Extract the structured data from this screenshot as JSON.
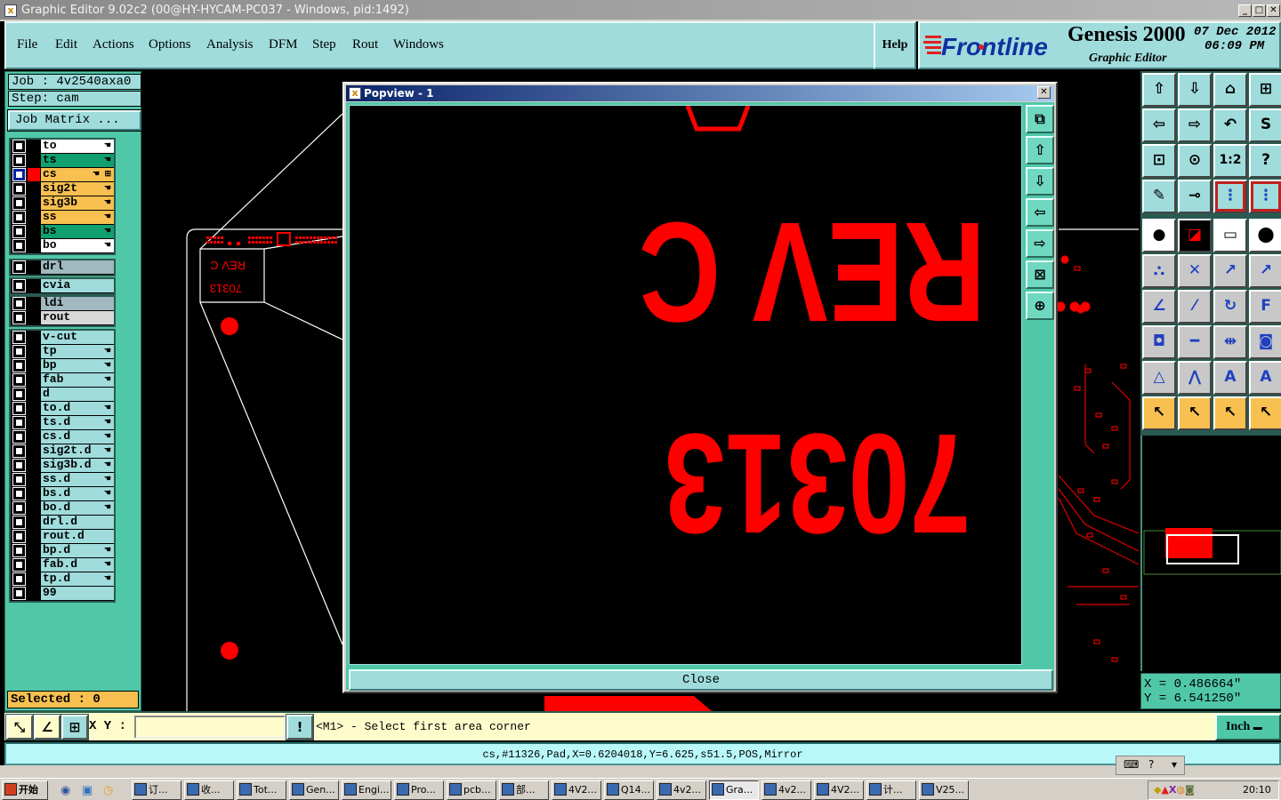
{
  "window": {
    "title": "Graphic Editor 9.02c2 (00@HY-HYCAM-PC037 - Windows, pid:1492)",
    "min": "_",
    "max": "□",
    "close": "✕"
  },
  "menu": {
    "items": [
      {
        "label": "File",
        "x": 0
      },
      {
        "label": "Edit"
      },
      {
        "label": "Actions"
      },
      {
        "label": "Options"
      },
      {
        "label": "Analysis"
      },
      {
        "label": "DFM"
      },
      {
        "label": "Step"
      },
      {
        "label": "Rout"
      },
      {
        "label": "Windows"
      }
    ],
    "help": "Help"
  },
  "branding": {
    "logo": "Frontline",
    "product": "Genesis 2000",
    "subtitle": "Graphic Editor",
    "date": "07 Dec 2012",
    "time": "06:09 PM"
  },
  "job": {
    "job_label": "Job : 4v2540axa0",
    "step_label": "Step: cam",
    "job_matrix": "Job Matrix ...",
    "selected": "Selected : 0"
  },
  "colors": {
    "orange": "#f8c050",
    "green": "#10a070",
    "white": "#ffffff",
    "gray": "#a0b8c0",
    "lightgray": "#d8d8d8",
    "teal": "#a0dcdc",
    "pcb_red": "#ff0000",
    "panel": "#50c8a8"
  },
  "layers": [
    {
      "name": "to",
      "color": "white",
      "hand": true,
      "group": 0
    },
    {
      "name": "ts",
      "color": "green",
      "hand": true,
      "group": 0
    },
    {
      "name": "cs",
      "color": "orange",
      "hand": true,
      "group": 0,
      "active": true
    },
    {
      "name": "sig2t",
      "color": "orange",
      "hand": true,
      "group": 0
    },
    {
      "name": "sig3b",
      "color": "orange",
      "hand": true,
      "group": 0
    },
    {
      "name": "ss",
      "color": "orange",
      "hand": true,
      "group": 0
    },
    {
      "name": "bs",
      "color": "green",
      "hand": true,
      "group": 0
    },
    {
      "name": "bo",
      "color": "white",
      "hand": true,
      "group": 0
    },
    {
      "name": "drl",
      "color": "gray",
      "hand": false,
      "group": 1
    },
    {
      "name": "cvia",
      "color": "teal",
      "hand": false,
      "group": 2
    },
    {
      "name": "ldi",
      "color": "gray",
      "hand": false,
      "group": 3
    },
    {
      "name": "rout",
      "color": "lightgray",
      "hand": false,
      "group": 3
    },
    {
      "name": "v-cut",
      "color": "teal",
      "hand": false,
      "group": 4
    },
    {
      "name": "tp",
      "color": "teal",
      "hand": true,
      "group": 4
    },
    {
      "name": "bp",
      "color": "teal",
      "hand": true,
      "group": 4
    },
    {
      "name": "fab",
      "color": "teal",
      "hand": true,
      "group": 4
    },
    {
      "name": "d",
      "color": "teal",
      "hand": false,
      "group": 4
    },
    {
      "name": "to.d",
      "color": "teal",
      "hand": true,
      "group": 4
    },
    {
      "name": "ts.d",
      "color": "teal",
      "hand": true,
      "group": 4
    },
    {
      "name": "cs.d",
      "color": "teal",
      "hand": true,
      "group": 4
    },
    {
      "name": "sig2t.d",
      "color": "teal",
      "hand": true,
      "group": 4
    },
    {
      "name": "sig3b.d",
      "color": "teal",
      "hand": true,
      "group": 4
    },
    {
      "name": "ss.d",
      "color": "teal",
      "hand": true,
      "group": 4
    },
    {
      "name": "bs.d",
      "color": "teal",
      "hand": true,
      "group": 4
    },
    {
      "name": "bo.d",
      "color": "teal",
      "hand": true,
      "group": 4
    },
    {
      "name": "drl.d",
      "color": "teal",
      "hand": false,
      "group": 4
    },
    {
      "name": "rout.d",
      "color": "teal",
      "hand": false,
      "group": 4
    },
    {
      "name": "bp.d",
      "color": "teal",
      "hand": true,
      "group": 4
    },
    {
      "name": "fab.d",
      "color": "teal",
      "hand": true,
      "group": 4
    },
    {
      "name": "tp.d",
      "color": "teal",
      "hand": true,
      "group": 4
    },
    {
      "name": "99",
      "color": "teal",
      "hand": false,
      "group": 4
    }
  ],
  "popview": {
    "title": "Popview - 1",
    "close_label": "Close",
    "text_line1": "REV C",
    "text_line2": "70313",
    "tools": [
      "zoom-window-icon",
      "pan-up-icon",
      "pan-down-icon",
      "pan-left-icon",
      "pan-right-icon",
      "zoom-in-icon",
      "zoom-out-icon"
    ]
  },
  "canvas_thumb": {
    "text_line1": "REV C",
    "text_line2": "70313"
  },
  "toolbar": {
    "view_tools": [
      {
        "icon": "pan-up-icon",
        "glyph": "⇧"
      },
      {
        "icon": "pan-down-icon",
        "glyph": "⇩"
      },
      {
        "icon": "home-icon",
        "glyph": "⌂"
      },
      {
        "icon": "xy-grid-icon",
        "glyph": "⊞"
      },
      {
        "icon": "pan-left-icon",
        "glyph": "⇦"
      },
      {
        "icon": "pan-right-icon",
        "glyph": "⇨"
      },
      {
        "icon": "undo-view-icon",
        "glyph": "↶"
      },
      {
        "icon": "snake-icon",
        "glyph": "S"
      },
      {
        "icon": "zoom-in-icon",
        "glyph": "⊡"
      },
      {
        "icon": "zoom-out-icon",
        "glyph": "⊙"
      },
      {
        "icon": "one-to-two-icon",
        "glyph": "1:2"
      },
      {
        "icon": "help-icon",
        "glyph": "?"
      },
      {
        "icon": "tools-palette-icon",
        "glyph": "✎"
      },
      {
        "icon": "snap-icon",
        "glyph": "⊸"
      },
      {
        "icon": "netlist-top-icon",
        "glyph": "⋮",
        "active": true
      },
      {
        "icon": "netlist-bottom-icon",
        "glyph": "⋮",
        "active": true
      }
    ],
    "edit_tools": [
      {
        "icon": "move-pad-icon",
        "glyph": "●",
        "style": "white"
      },
      {
        "icon": "measure-pads-icon",
        "glyph": "◪",
        "style": "black"
      },
      {
        "icon": "ruler-icon",
        "glyph": "▭",
        "style": "white"
      },
      {
        "icon": "pad-select-icon",
        "glyph": "⬤",
        "style": "white"
      },
      {
        "icon": "connect-icon",
        "glyph": "⛬",
        "style": "gray"
      },
      {
        "icon": "delete-feature-icon",
        "glyph": "✕",
        "style": "gray"
      },
      {
        "icon": "move-circle-icon",
        "glyph": "↗",
        "style": "gray"
      },
      {
        "icon": "copy-circle-icon",
        "glyph": "↗",
        "style": "gray"
      },
      {
        "icon": "angle-icon",
        "glyph": "∠",
        "style": "gray"
      },
      {
        "icon": "line-icon",
        "glyph": "⁄",
        "style": "gray"
      },
      {
        "icon": "rotate-icon",
        "glyph": "↻",
        "style": "gray"
      },
      {
        "icon": "mirror-icon",
        "glyph": "F",
        "style": "gray"
      },
      {
        "icon": "move-square-icon",
        "glyph": "◘",
        "style": "gray"
      },
      {
        "icon": "segment-icon",
        "glyph": "━",
        "style": "gray"
      },
      {
        "icon": "dimension-icon",
        "glyph": "⇹",
        "style": "gray"
      },
      {
        "icon": "shapes-icon",
        "glyph": "◙",
        "style": "gray"
      },
      {
        "icon": "triangle-icon",
        "glyph": "△",
        "style": "gray"
      },
      {
        "icon": "peak-icon",
        "glyph": "⋀",
        "style": "gray"
      },
      {
        "icon": "arch-icon",
        "glyph": "A",
        "style": "gray"
      },
      {
        "icon": "arch-cut-icon",
        "glyph": "A",
        "style": "gray"
      },
      {
        "icon": "select-arrow-icon",
        "glyph": "↖",
        "style": "orange"
      },
      {
        "icon": "select-box-icon",
        "glyph": "↖",
        "style": "orange"
      },
      {
        "icon": "select-polygon-icon",
        "glyph": "↖",
        "style": "orange"
      },
      {
        "icon": "select-net-icon",
        "glyph": "↖",
        "style": "orange"
      }
    ]
  },
  "coords": {
    "x": "X = 0.486664\"",
    "y": "Y = 6.541250\""
  },
  "command": {
    "xy_label": "X Y :",
    "xy_value": "",
    "prompt": "<M1> - Select first area corner",
    "units": "Inch"
  },
  "status": "cs,#11326,Pad,X=0.6204018,Y=6.625,s51.5,POS,Mirror",
  "taskbar": {
    "start": "开始",
    "tasks": [
      "订...",
      "收...",
      "Tot...",
      "Gen...",
      "Engi...",
      "Pro...",
      "pcb...",
      "部...",
      "4V2...",
      "Q14...",
      "4v2...",
      "Gra...",
      "4v2...",
      "4V2...",
      "计...",
      "V25..."
    ],
    "active_task": "Gra...",
    "clock": "20:10"
  }
}
